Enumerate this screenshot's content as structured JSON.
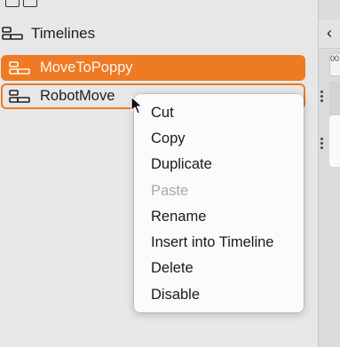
{
  "sidebar": {
    "section_title": "Timelines",
    "items": [
      {
        "label": "MoveToPoppy",
        "state": "selected"
      },
      {
        "label": "RobotMove",
        "state": "context-target"
      }
    ]
  },
  "right_pane": {
    "ruler_text": "00"
  },
  "context_menu": {
    "items": [
      {
        "label": "Cut",
        "enabled": true
      },
      {
        "label": "Copy",
        "enabled": true
      },
      {
        "label": "Duplicate",
        "enabled": true
      },
      {
        "label": "Paste",
        "enabled": false
      },
      {
        "label": "Rename",
        "enabled": true
      },
      {
        "label": "Insert into Timeline",
        "enabled": true
      },
      {
        "label": "Delete",
        "enabled": true
      },
      {
        "label": "Disable",
        "enabled": true
      }
    ]
  },
  "colors": {
    "accent": "#ee7a24",
    "sidebar_bg": "#e8e7e7",
    "menu_bg": "#fbfbfb"
  },
  "icons": {
    "timeline": "timeline-icon",
    "chevron": "chevron-left-icon",
    "cursor": "mouse-pointer-icon"
  }
}
